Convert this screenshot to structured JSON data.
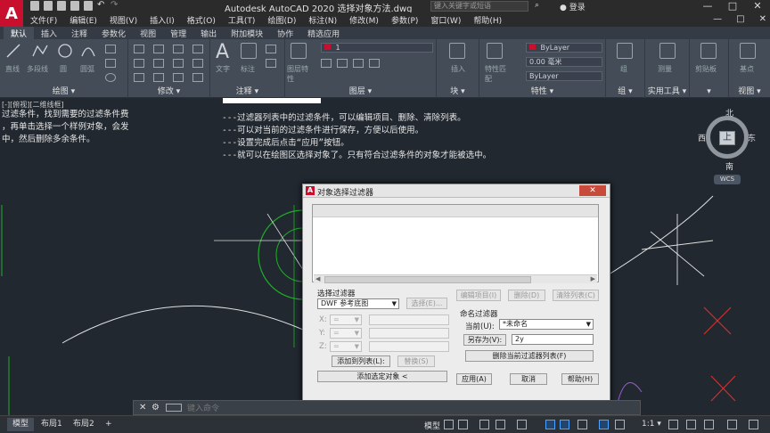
{
  "app": {
    "logo": "A",
    "title": "Autodesk AutoCAD 2020    选择对象方法.dwg",
    "search_placeholder": "键入关键字或短语",
    "login": "登录",
    "window_controls": [
      "—",
      "□",
      "✕"
    ],
    "doc_controls": [
      "—",
      "□",
      "✕"
    ]
  },
  "menu": [
    "文件(F)",
    "编辑(E)",
    "视图(V)",
    "插入(I)",
    "格式(O)",
    "工具(T)",
    "绘图(D)",
    "标注(N)",
    "修改(M)",
    "参数(P)",
    "窗口(W)",
    "帮助(H)"
  ],
  "ribbon_tabs": [
    {
      "label": "默认",
      "active": true
    },
    {
      "label": "插入",
      "active": false
    },
    {
      "label": "注释",
      "active": false
    },
    {
      "label": "参数化",
      "active": false
    },
    {
      "label": "视图",
      "active": false
    },
    {
      "label": "管理",
      "active": false
    },
    {
      "label": "输出",
      "active": false
    },
    {
      "label": "附加模块",
      "active": false
    },
    {
      "label": "协作",
      "active": false
    },
    {
      "label": "精选应用",
      "active": false
    }
  ],
  "ribbon_panels": {
    "draw": {
      "title": "绘图 ▾",
      "tools": [
        "直线",
        "多段线",
        "圆",
        "圆弧"
      ]
    },
    "modify": {
      "title": "修改 ▾"
    },
    "annotation": {
      "title": "注释 ▾",
      "tools": [
        "文字",
        "标注"
      ]
    },
    "layers": {
      "title": "图层 ▾",
      "tools": [
        "图层特性"
      ],
      "current_layer": "1"
    },
    "block": {
      "title": "块 ▾",
      "tools": [
        "插入"
      ]
    },
    "properties": {
      "title": "特性 ▾",
      "tools": [
        "特性匹配"
      ],
      "color": "ByLayer",
      "lineweight": "0.00 毫米",
      "linetype": "ByLayer"
    },
    "groups": {
      "title": "组 ▾",
      "tools": [
        "组"
      ]
    },
    "utilities": {
      "title": "实用工具 ▾",
      "tools": [
        "测量"
      ]
    },
    "clipboard": {
      "title": "▾",
      "tools": [
        "剪贴板"
      ]
    },
    "view": {
      "title": "视图 ▾",
      "tools": [
        "基点"
      ]
    }
  },
  "canvas": {
    "viewport_label": "[-][俯视][二维线框]",
    "left_text": [
      "过滤条件，找到需要的过滤条件费",
      "，再单击选择一个样例对象，会发",
      "中，然后删除多余条件。"
    ],
    "center_text": [
      "---过滤器列表中的过滤条件，可以编辑项目、删除、清除列表。",
      "---可以对当前的过滤条件进行保存，方便以后使用。",
      "---设置完成后点击“应用”按钮。",
      "---就可以在绘图区选择对象了。只有符合过滤条件的对象才能被选中。"
    ],
    "viewcube": {
      "north": "北",
      "south": "南",
      "west": "西",
      "east": "东",
      "top": "上"
    },
    "wcs": "WCS"
  },
  "dialog": {
    "logo": "A",
    "title": "对象选择过滤器",
    "close": "✕",
    "select_filter_label": "选择过滤器",
    "select_filter_value": "DWF 参考底图",
    "select_button": "选择(E)...",
    "x_label": "X:",
    "y_label": "Y:",
    "z_label": "Z:",
    "op_value": "=",
    "add_to_list": "添加到列表(L):",
    "replace": "替换(S)",
    "add_selected": "添加选定对象 <",
    "edit_item": "编辑项目(I)",
    "delete": "删除(D)",
    "clear_list": "清除列表(C)",
    "named_filters_label": "命名过滤器",
    "current_label": "当前(U):",
    "current_value": "*未命名",
    "save_as": "另存为(V):",
    "save_as_value": "2y",
    "delete_current": "删除当前过滤器列表(F)",
    "apply": "应用(A)",
    "cancel": "取消",
    "help": "帮助(H)"
  },
  "command": {
    "close": "✕",
    "placeholder": "键入命令"
  },
  "status": {
    "layout_tabs": [
      {
        "label": "模型",
        "active": true
      },
      {
        "label": "布局1",
        "active": false
      },
      {
        "label": "布局2",
        "active": false
      },
      {
        "label": "+",
        "active": false
      }
    ],
    "model_label": "模型",
    "scale": "1:1 ▾"
  },
  "colors": {
    "canvas_bg": "#212830",
    "ribbon_bg": "#444c58",
    "accent_red": "#c8102e",
    "green_geometry": "#1fae2a"
  }
}
